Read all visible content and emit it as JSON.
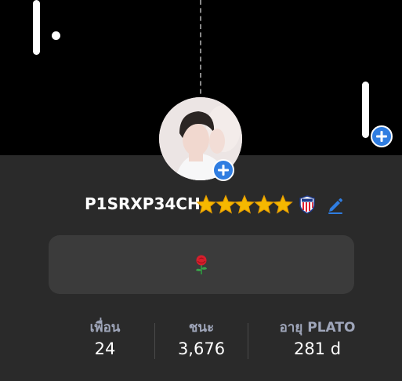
{
  "profile": {
    "username": "P1SRXP34CH",
    "star_rating": 5,
    "badge_icon": "shield-badge-icon",
    "bio": "🌹"
  },
  "stats": [
    {
      "label": "เพื่อน",
      "value": "24"
    },
    {
      "label": "ชนะ",
      "value": "3,676"
    },
    {
      "label": "อายุ PLATO",
      "value": "281 d"
    }
  ],
  "colors": {
    "accent": "#2f7de1",
    "page_bg": "#2a2a2a",
    "cover_bg": "#000000",
    "card_bg": "#3b3b3b",
    "stat_label": "#9fa6ba",
    "star": "#f5b800"
  }
}
